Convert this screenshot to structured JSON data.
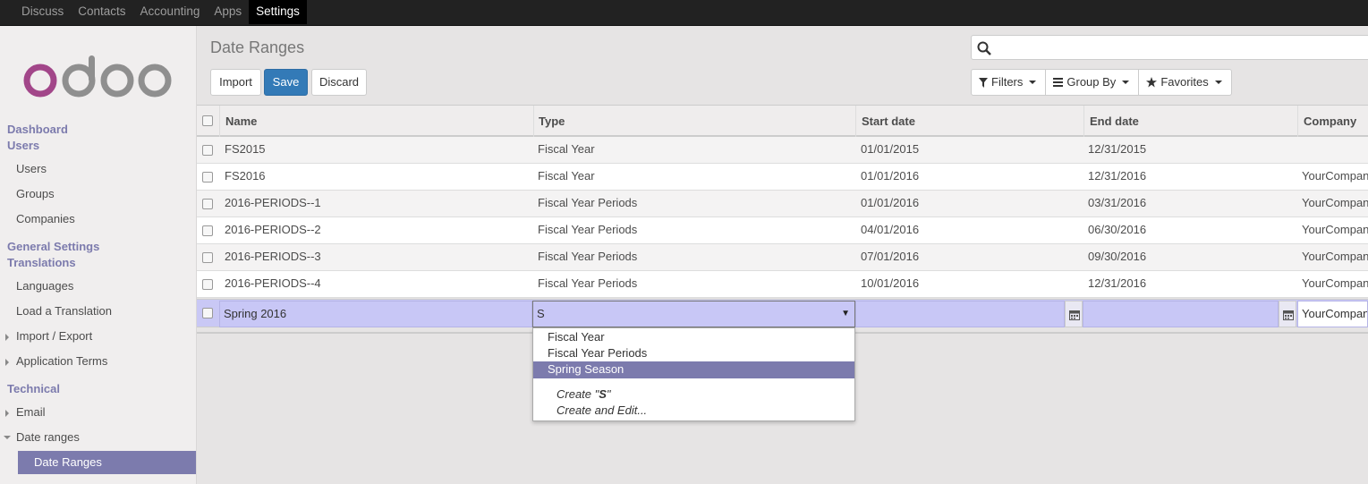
{
  "topbar": {
    "items": [
      "Discuss",
      "Contacts",
      "Accounting",
      "Apps",
      "Settings"
    ],
    "active": "Settings"
  },
  "sidebar": {
    "sections": [
      {
        "heading": "Dashboard"
      },
      {
        "heading": "Users",
        "items": [
          "Users",
          "Groups",
          "Companies"
        ]
      },
      {
        "heading": "General Settings"
      },
      {
        "heading": "Translations",
        "items": [
          "Languages",
          "Load a Translation",
          "Import / Export",
          "Application Terms"
        ]
      },
      {
        "heading": "Technical",
        "items": [
          "Email",
          "Date ranges"
        ]
      }
    ],
    "active_item": "Date Ranges"
  },
  "page": {
    "title": "Date Ranges",
    "buttons": {
      "import": "Import",
      "save": "Save",
      "discard": "Discard"
    },
    "search_placeholder": "",
    "filters": {
      "filters": "Filters",
      "groupby": "Group By",
      "favorites": "Favorites"
    }
  },
  "table": {
    "columns": [
      "Name",
      "Type",
      "Start date",
      "End date",
      "Company"
    ],
    "rows": [
      {
        "name": "FS2015",
        "type": "Fiscal Year",
        "start": "01/01/2015",
        "end": "12/31/2015",
        "company": ""
      },
      {
        "name": "FS2016",
        "type": "Fiscal Year",
        "start": "01/01/2016",
        "end": "12/31/2016",
        "company": "YourCompany"
      },
      {
        "name": "2016-PERIODS--1",
        "type": "Fiscal Year Periods",
        "start": "01/01/2016",
        "end": "03/31/2016",
        "company": "YourCompany"
      },
      {
        "name": "2016-PERIODS--2",
        "type": "Fiscal Year Periods",
        "start": "04/01/2016",
        "end": "06/30/2016",
        "company": "YourCompany"
      },
      {
        "name": "2016-PERIODS--3",
        "type": "Fiscal Year Periods",
        "start": "07/01/2016",
        "end": "09/30/2016",
        "company": "YourCompany"
      },
      {
        "name": "2016-PERIODS--4",
        "type": "Fiscal Year Periods",
        "start": "10/01/2016",
        "end": "12/31/2016",
        "company": "YourCompany"
      }
    ],
    "edit_row": {
      "name": "Spring 2016",
      "type": "S",
      "start": "",
      "end": "",
      "company": "YourCompany"
    }
  },
  "dropdown": {
    "options": [
      "Fiscal Year",
      "Fiscal Year Periods",
      "Spring Season"
    ],
    "selected": "Spring Season",
    "create_prefix": "Create \"",
    "create_term": "S",
    "create_suffix": "\"",
    "create_edit": "Create and Edit..."
  },
  "colors": {
    "accent": "#7c7bad",
    "primary": "#337ab7",
    "topbar": "#222222"
  }
}
